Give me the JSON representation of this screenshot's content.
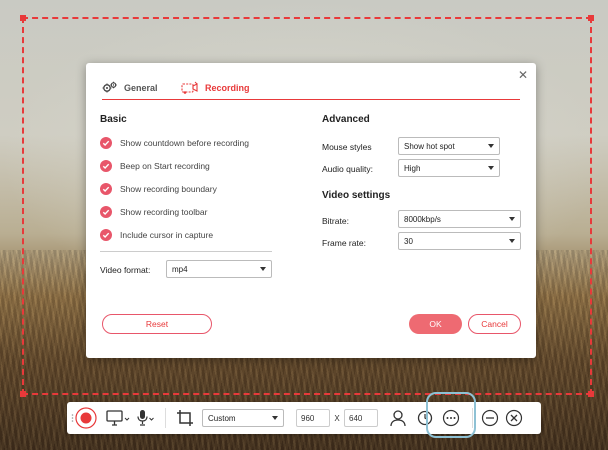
{
  "dialog": {
    "tabs": [
      {
        "label": "General",
        "icon": "gears-icon",
        "active": false
      },
      {
        "label": "Recording",
        "icon": "recording-icon",
        "active": true
      }
    ],
    "basic": {
      "title": "Basic",
      "options": [
        {
          "label": "Show countdown before recording",
          "checked": true
        },
        {
          "label": "Beep on Start recording",
          "checked": true
        },
        {
          "label": "Show recording boundary",
          "checked": true
        },
        {
          "label": "Show recording toolbar",
          "checked": true
        },
        {
          "label": "Include cursor in capture",
          "checked": true
        }
      ],
      "video_format_label": "Video format:",
      "video_format_value": "mp4"
    },
    "advanced": {
      "title": "Advanced",
      "mouse_styles_label": "Mouse styles",
      "mouse_styles_value": "Show hot spot",
      "audio_quality_label": "Audio quality:",
      "audio_quality_value": "High"
    },
    "video_settings": {
      "title": "Video settings",
      "bitrate_label": "Bitrate:",
      "bitrate_value": "8000kbp/s",
      "frame_rate_label": "Frame rate:",
      "frame_rate_value": "30"
    },
    "buttons": {
      "reset": "Reset",
      "ok": "OK",
      "cancel": "Cancel"
    }
  },
  "toolbar": {
    "size_preset": "Custom",
    "width": "960",
    "x_label": "X",
    "height": "640"
  },
  "colors": {
    "accent": "#e8393a",
    "check": "#e8566a",
    "ok_button": "#ee6a72",
    "highlight": "#8ec1d4"
  }
}
